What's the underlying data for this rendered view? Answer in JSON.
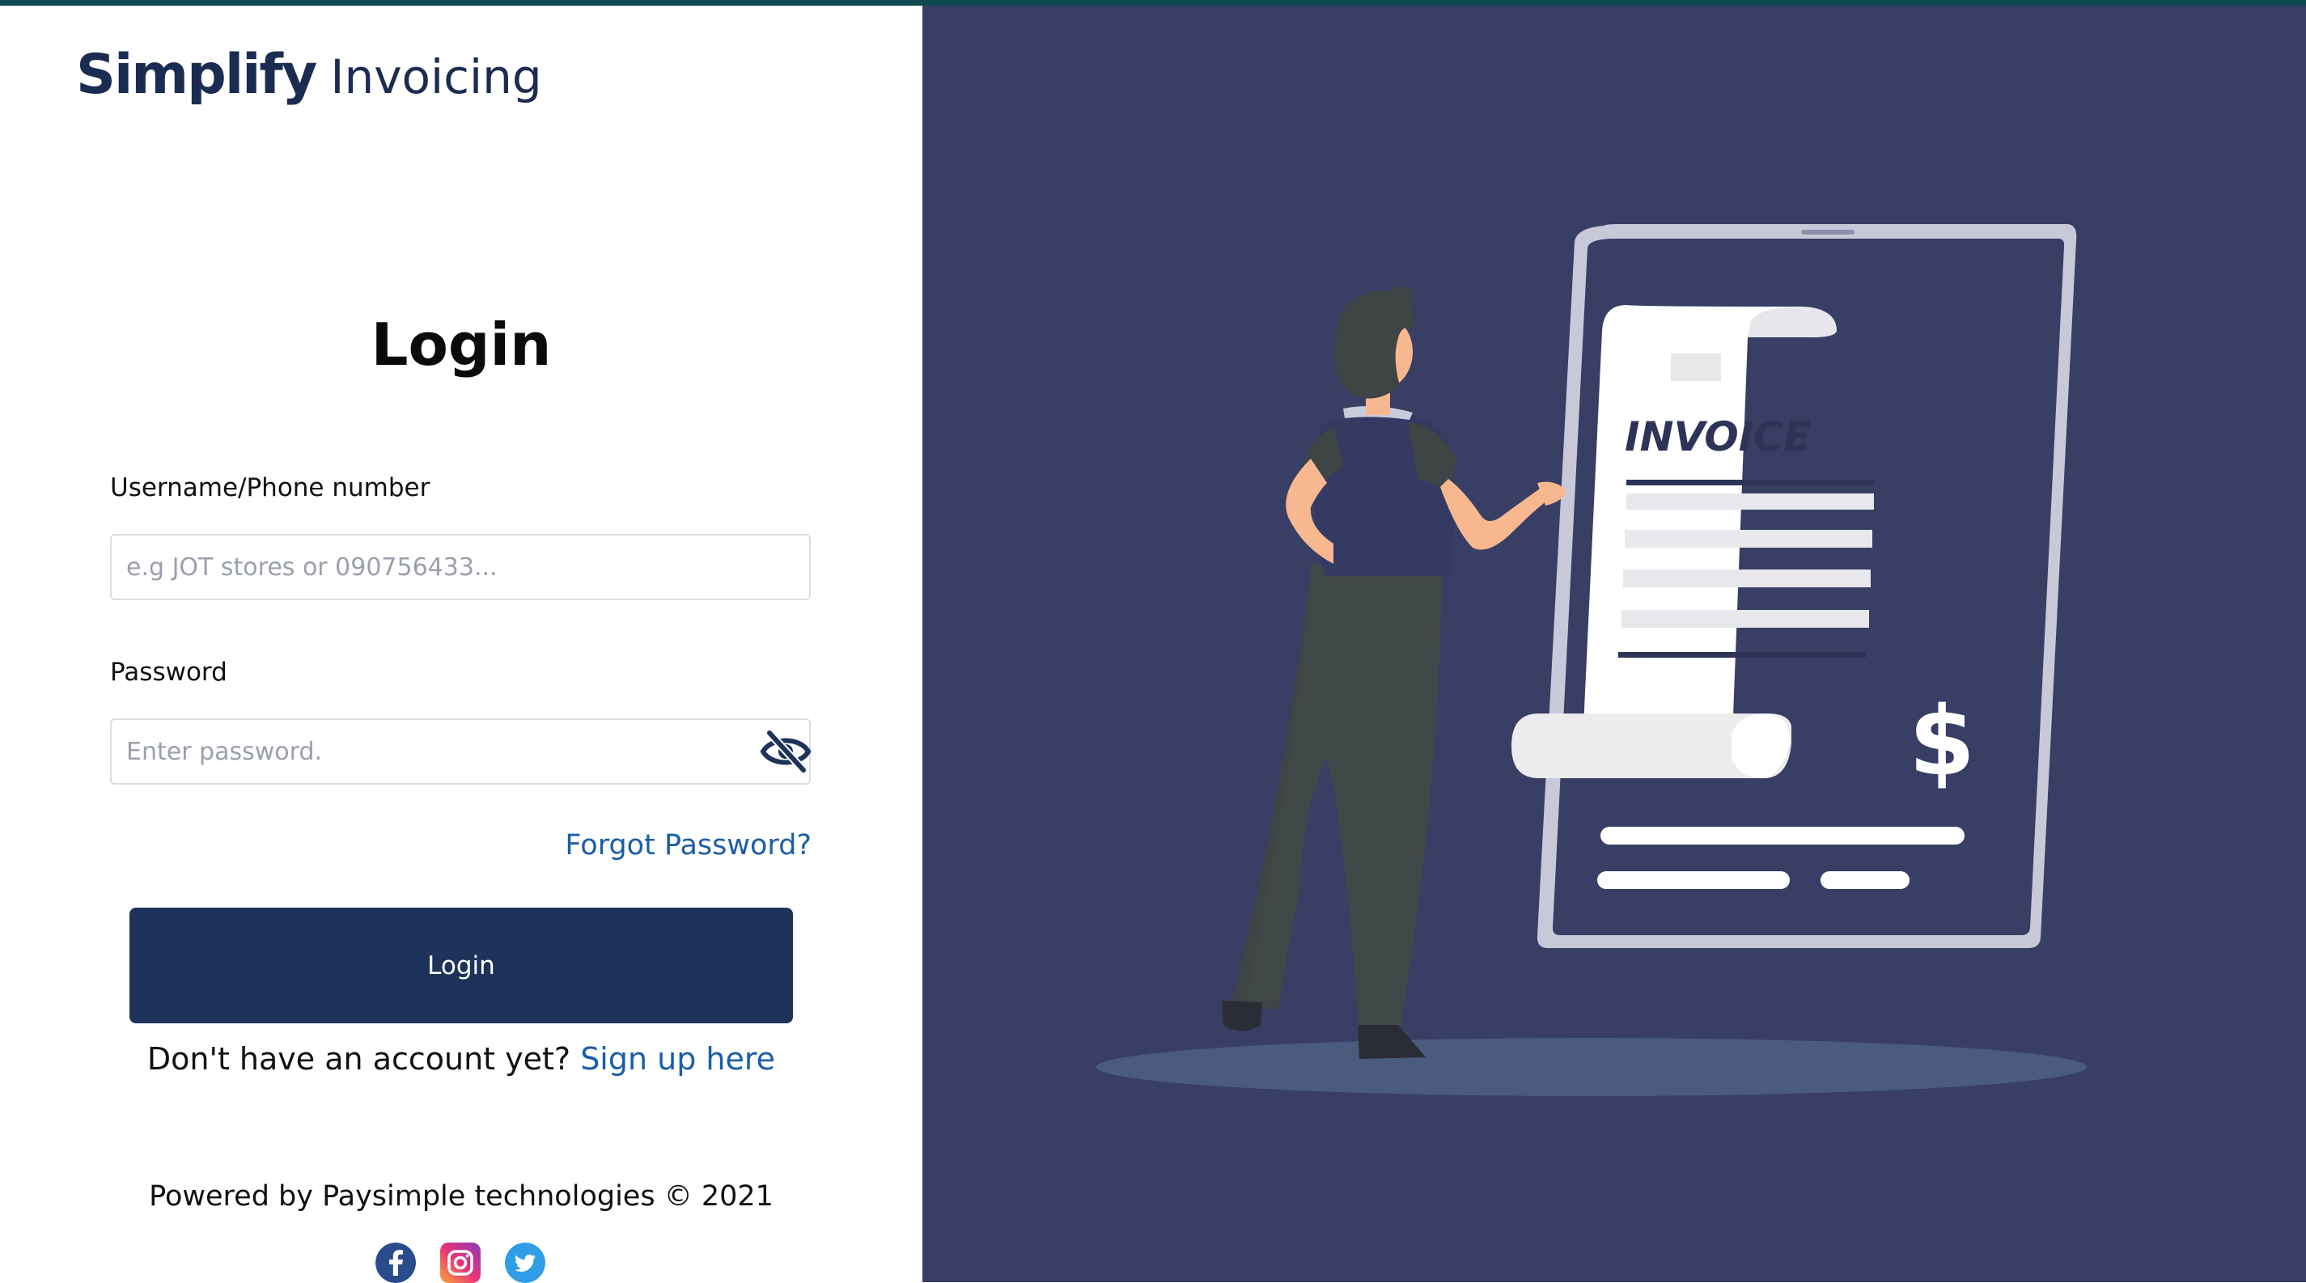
{
  "brand": {
    "name": "Simplify",
    "product": "Invoicing"
  },
  "page": {
    "title": "Login"
  },
  "form": {
    "username_label": "Username/Phone number",
    "username_placeholder": "e.g JOT stores or 090756433...",
    "username_value": "",
    "password_label": "Password",
    "password_placeholder": "Enter password.",
    "password_value": "",
    "password_toggle_icon": "eye-slash-icon",
    "forgot_label": "Forgot Password?",
    "submit_label": "Login"
  },
  "signup": {
    "prompt": "Don't have an account yet?",
    "link": "Sign up here"
  },
  "footer": {
    "powered_by": "Powered by Paysimple technologies © 2021",
    "socials": [
      "facebook-icon",
      "instagram-icon",
      "twitter-icon"
    ]
  },
  "illustration": {
    "document_title": "INVOICE",
    "currency_symbol": "$"
  },
  "colors": {
    "primary": "#1d3359",
    "link": "#1b5ea8",
    "panel": "#383e64",
    "top_strip": "#0f4a50"
  }
}
